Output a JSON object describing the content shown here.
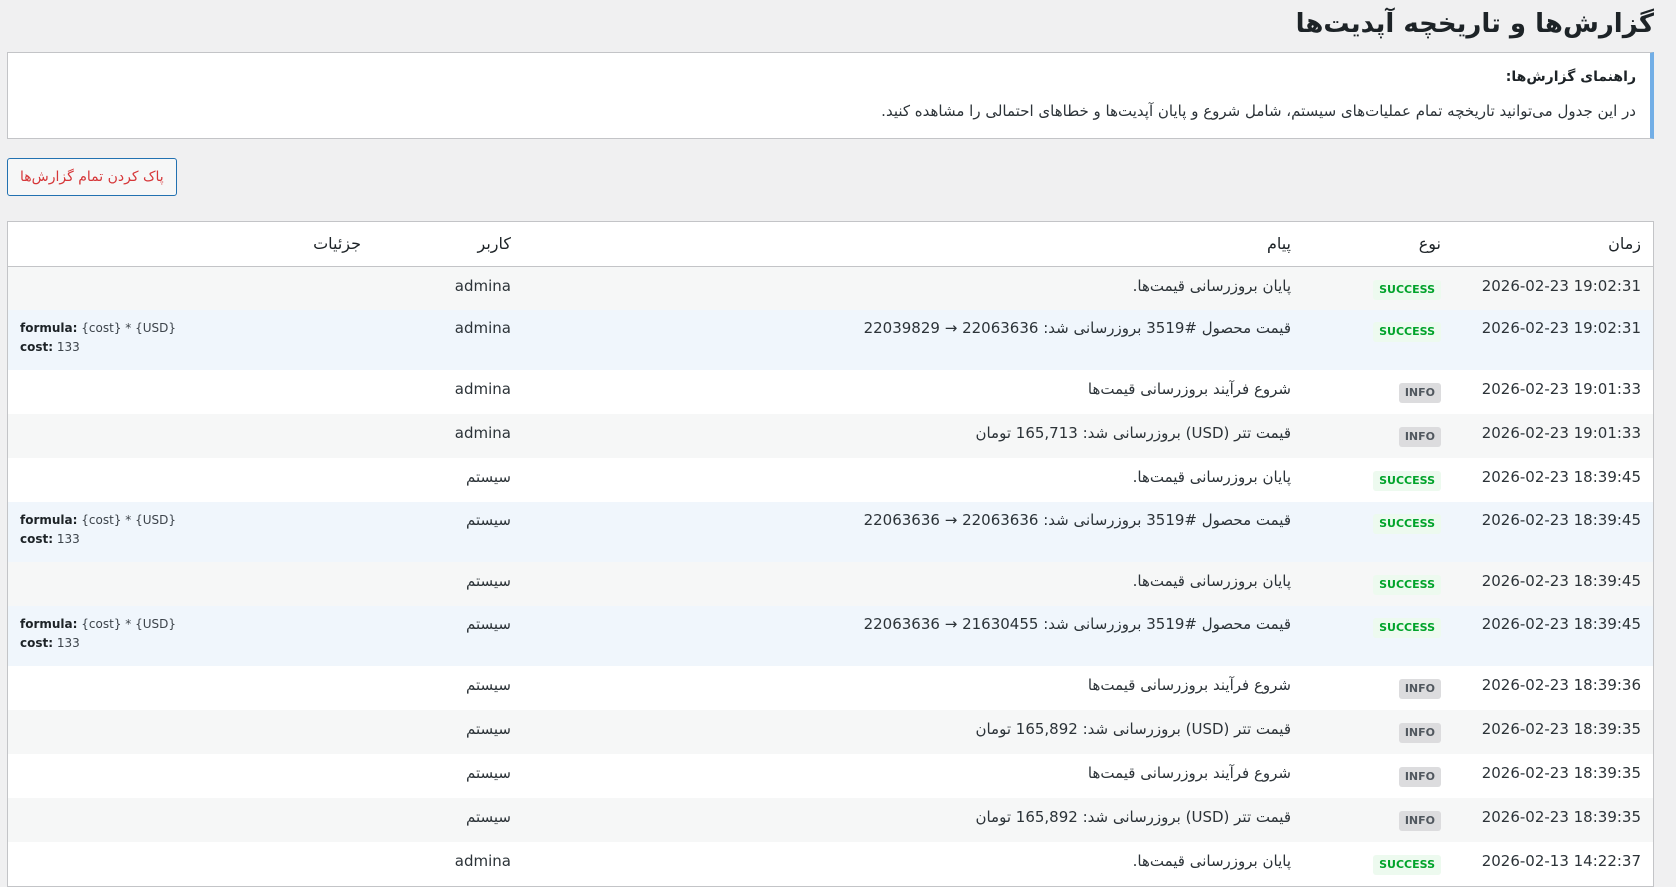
{
  "page": {
    "title": "گزارش‌ها و تاریخچه آپدیت‌ها"
  },
  "notice": {
    "title": "راهنمای گزارش‌ها:",
    "text": "در این جدول می‌توانید تاریخچه تمام عملیات‌های سیستم، شامل شروع و پایان آپدیت‌ها و خطاهای احتمالی را مشاهده کنید."
  },
  "actions": {
    "clear_label": "پاک کردن تمام گزارش‌ها"
  },
  "table": {
    "headers": {
      "time": "زمان",
      "type": "نوع",
      "message": "پیام",
      "user": "کاربر",
      "details": "جزئیات"
    },
    "rows": [
      {
        "time": "2026-02-23 19:02:31",
        "type": "SUCCESS",
        "message": "پایان بروزرسانی قیمت‌ها.",
        "user": "admina"
      },
      {
        "time": "2026-02-23 19:02:31",
        "type": "SUCCESS",
        "message": "قیمت محصول #3519 بروزرسانی شد: 22063636 → 22039829",
        "user": "admina",
        "details": {
          "formula_key": "formula:",
          "formula": "{cost} * {USD}",
          "cost_key": "cost:",
          "cost": "133"
        }
      },
      {
        "time": "2026-02-23 19:01:33",
        "type": "INFO",
        "message": "شروع فرآیند بروزرسانی قیمت‌ها",
        "user": "admina"
      },
      {
        "time": "2026-02-23 19:01:33",
        "type": "INFO",
        "message": "قیمت تتر (USD) بروزرسانی شد: 165,713 تومان",
        "user": "admina"
      },
      {
        "time": "2026-02-23 18:39:45",
        "type": "SUCCESS",
        "message": "پایان بروزرسانی قیمت‌ها.",
        "user": "سیستم"
      },
      {
        "time": "2026-02-23 18:39:45",
        "type": "SUCCESS",
        "message": "قیمت محصول #3519 بروزرسانی شد: 22063636 → 22063636",
        "user": "سیستم",
        "details": {
          "formula_key": "formula:",
          "formula": "{cost} * {USD}",
          "cost_key": "cost:",
          "cost": "133"
        }
      },
      {
        "time": "2026-02-23 18:39:45",
        "type": "SUCCESS",
        "message": "پایان بروزرسانی قیمت‌ها.",
        "user": "سیستم"
      },
      {
        "time": "2026-02-23 18:39:45",
        "type": "SUCCESS",
        "message": "قیمت محصول #3519 بروزرسانی شد: 21630455 → 22063636",
        "user": "سیستم",
        "details": {
          "formula_key": "formula:",
          "formula": "{cost} * {USD}",
          "cost_key": "cost:",
          "cost": "133"
        }
      },
      {
        "time": "2026-02-23 18:39:36",
        "type": "INFO",
        "message": "شروع فرآیند بروزرسانی قیمت‌ها",
        "user": "سیستم"
      },
      {
        "time": "2026-02-23 18:39:35",
        "type": "INFO",
        "message": "قیمت تتر (USD) بروزرسانی شد: 165,892 تومان",
        "user": "سیستم"
      },
      {
        "time": "2026-02-23 18:39:35",
        "type": "INFO",
        "message": "شروع فرآیند بروزرسانی قیمت‌ها",
        "user": "سیستم"
      },
      {
        "time": "2026-02-23 18:39:35",
        "type": "INFO",
        "message": "قیمت تتر (USD) بروزرسانی شد: 165,892 تومان",
        "user": "سیستم"
      },
      {
        "time": "2026-02-13 14:22:37",
        "type": "SUCCESS",
        "message": "پایان بروزرسانی قیمت‌ها.",
        "user": "admina"
      }
    ]
  }
}
